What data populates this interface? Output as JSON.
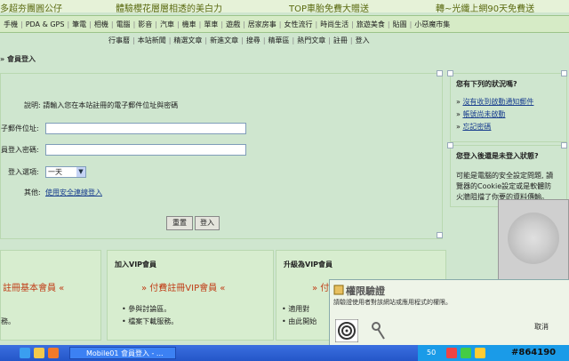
{
  "promo": [
    "多超夯團圓公仔",
    "體驗櫻花層層相透的美白力",
    "TOP車胎免費大贈送",
    "轉~光纖上網90天免費送"
  ],
  "categories": [
    "手機",
    "PDA & GPS",
    "筆電",
    "相機",
    "電腦",
    "影音",
    "汽車",
    "機車",
    "單車",
    "遊戲",
    "居家房事",
    "女性流行",
    "時尚生活",
    "旅遊美食",
    "貼圖",
    "小惡魔市集"
  ],
  "subnav": [
    "行事曆",
    "本站新聞",
    "精選文章",
    "新進文章",
    "搜尋",
    "精華區",
    "熱門文章",
    "註冊",
    "登入"
  ],
  "breadcrumb": "» 會員登入",
  "form": {
    "instructions": "說明: 請輸入您在本站註冊的電子郵件位址與密碼",
    "email_label": "子郵件位址:",
    "email_value": "",
    "password_label": "員登入密碼:",
    "password_value": "",
    "option_label": "登入選項:",
    "option_value": "一天",
    "other_label": "其他:",
    "secure_link": "使用安全連線登入",
    "reset_label": "重置",
    "login_label": "登入"
  },
  "sidebar": {
    "box1_title": "您有下列的狀況嗎?",
    "box1_items": [
      "沒有收到啟動通知郵件",
      "帳號尚未啟動",
      "忘記密碼"
    ],
    "box2_title": "您登入後還是未登入狀態?",
    "box2_text": [
      "可能是電腦的安全設定問題, 讀",
      "覽器的Cookie設定或是軟體防",
      "火牆阻擋了你要的資料傳輸。"
    ]
  },
  "vip": {
    "col1_btn": "註冊基本會員 «",
    "col1_items": [
      "務。"
    ],
    "col2_title": "加入VIP會員",
    "col2_btn": "» 付費註冊VIP會員 «",
    "col2_items": [
      "參與討論區。",
      "檔案下載服務。"
    ],
    "col3_title": "升級為VIP會員",
    "col3_btn": "» 付",
    "col3_items": [
      "適用對",
      "由此開始"
    ]
  },
  "popup": {
    "title": "權限驗證",
    "text": "請驗證使用者對該網站或應用程式的權限。",
    "cancel": "取消"
  },
  "taskbar": {
    "window_title": "Mobile01 會員登入 - ...",
    "tray_number": "50"
  },
  "watermark": "#864190",
  "colors": {
    "page_bg": "#cfe6cf",
    "link": "#1a3f8f",
    "vip_accent": "#c03a14",
    "taskbar": "#2456c8"
  }
}
